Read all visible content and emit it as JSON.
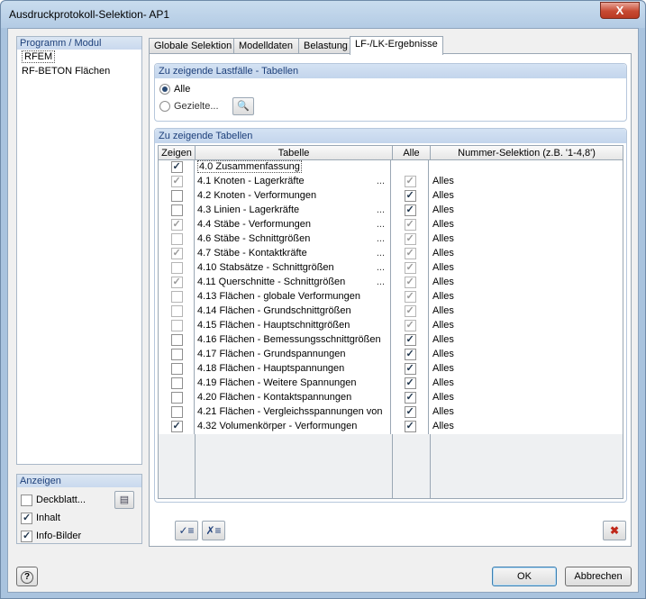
{
  "window": {
    "title": "Ausdruckprotokoll-Selektion- AP1",
    "close_label": "X"
  },
  "program_module": {
    "header": "Programm / Modul",
    "items": [
      {
        "label": "RFEM",
        "selected": true
      },
      {
        "label": "RF-BETON Flächen",
        "selected": false
      }
    ]
  },
  "show": {
    "header": "Anzeigen",
    "items": [
      {
        "label": "Deckblatt...",
        "checked": false
      },
      {
        "label": "Inhalt",
        "checked": true
      },
      {
        "label": "Info-Bilder",
        "checked": true
      }
    ]
  },
  "tabs": [
    {
      "label": "Globale Selektion",
      "active": false
    },
    {
      "label": "Modelldaten",
      "active": false
    },
    {
      "label": "Belastung",
      "active": false
    },
    {
      "label": "LF-/LK-Ergebnisse",
      "active": true
    }
  ],
  "loadcases": {
    "header": "Zu zeigende Lastfälle - Tabellen",
    "options": [
      {
        "label": "Alle",
        "selected": true
      },
      {
        "label": "Gezielte...",
        "selected": false
      }
    ]
  },
  "tables": {
    "header": "Zu zeigende Tabellen",
    "columns": [
      "Zeigen",
      "Tabelle",
      "Alle",
      "Nummer-Selektion (z.B. '1-4,8')"
    ],
    "rows": [
      {
        "show": true,
        "show_grey": false,
        "name": "4.0 Zusammenfassung",
        "dots": false,
        "all": null,
        "all_grey": false,
        "selection": ""
      },
      {
        "show": true,
        "show_grey": true,
        "name": "4.1 Knoten - Lagerkräfte",
        "dots": true,
        "all": true,
        "all_grey": true,
        "selection": "Alles"
      },
      {
        "show": false,
        "show_grey": false,
        "name": "4.2 Knoten - Verformungen",
        "dots": false,
        "all": true,
        "all_grey": false,
        "selection": "Alles"
      },
      {
        "show": false,
        "show_grey": false,
        "name": "4.3 Linien - Lagerkräfte",
        "dots": true,
        "all": true,
        "all_grey": false,
        "selection": "Alles"
      },
      {
        "show": true,
        "show_grey": true,
        "name": "4.4 Stäbe - Verformungen",
        "dots": true,
        "all": true,
        "all_grey": true,
        "selection": "Alles"
      },
      {
        "show": false,
        "show_grey": true,
        "name": "4.6 Stäbe - Schnittgrößen",
        "dots": true,
        "all": true,
        "all_grey": true,
        "selection": "Alles"
      },
      {
        "show": true,
        "show_grey": true,
        "name": "4.7 Stäbe - Kontaktkräfte",
        "dots": true,
        "all": true,
        "all_grey": true,
        "selection": "Alles"
      },
      {
        "show": false,
        "show_grey": true,
        "name": "4.10 Stabsätze - Schnittgrößen",
        "dots": true,
        "all": true,
        "all_grey": true,
        "selection": "Alles"
      },
      {
        "show": true,
        "show_grey": true,
        "name": "4.11 Querschnitte - Schnittgrößen",
        "dots": true,
        "all": true,
        "all_grey": true,
        "selection": "Alles"
      },
      {
        "show": false,
        "show_grey": true,
        "name": "4.13 Flächen - globale Verformungen",
        "dots": false,
        "all": true,
        "all_grey": true,
        "selection": "Alles"
      },
      {
        "show": false,
        "show_grey": true,
        "name": "4.14 Flächen - Grundschnittgrößen",
        "dots": false,
        "all": true,
        "all_grey": true,
        "selection": "Alles"
      },
      {
        "show": false,
        "show_grey": true,
        "name": "4.15 Flächen - Hauptschnittgrößen",
        "dots": false,
        "all": true,
        "all_grey": true,
        "selection": "Alles"
      },
      {
        "show": false,
        "show_grey": false,
        "name": "4.16 Flächen - Bemessungsschnittgrößen",
        "dots": false,
        "all": true,
        "all_grey": false,
        "selection": "Alles"
      },
      {
        "show": false,
        "show_grey": false,
        "name": "4.17 Flächen - Grundspannungen",
        "dots": false,
        "all": true,
        "all_grey": false,
        "selection": "Alles"
      },
      {
        "show": false,
        "show_grey": false,
        "name": "4.18 Flächen - Hauptspannungen",
        "dots": false,
        "all": true,
        "all_grey": false,
        "selection": "Alles"
      },
      {
        "show": false,
        "show_grey": false,
        "name": "4.19 Flächen - Weitere Spannungen",
        "dots": false,
        "all": true,
        "all_grey": false,
        "selection": "Alles"
      },
      {
        "show": false,
        "show_grey": false,
        "name": "4.20 Flächen - Kontaktspannungen",
        "dots": false,
        "all": true,
        "all_grey": false,
        "selection": "Alles"
      },
      {
        "show": false,
        "show_grey": false,
        "name": "4.21 Flächen - Vergleichsspannungen von",
        "dots": false,
        "all": true,
        "all_grey": false,
        "selection": "Alles"
      },
      {
        "show": true,
        "show_grey": false,
        "name": "4.32 Volumenkörper - Verformungen",
        "dots": false,
        "all": true,
        "all_grey": false,
        "selection": "Alles"
      }
    ]
  },
  "buttons": {
    "ok": "OK",
    "cancel": "Abbrechen",
    "help": "?"
  },
  "icons": {
    "check_all": "check-all-icon",
    "uncheck_all": "uncheck-all-icon",
    "delete": "delete-icon",
    "select_loadcases": "magnifier-icon",
    "cover_edit": "edit-cover-icon",
    "help": "help-icon"
  }
}
